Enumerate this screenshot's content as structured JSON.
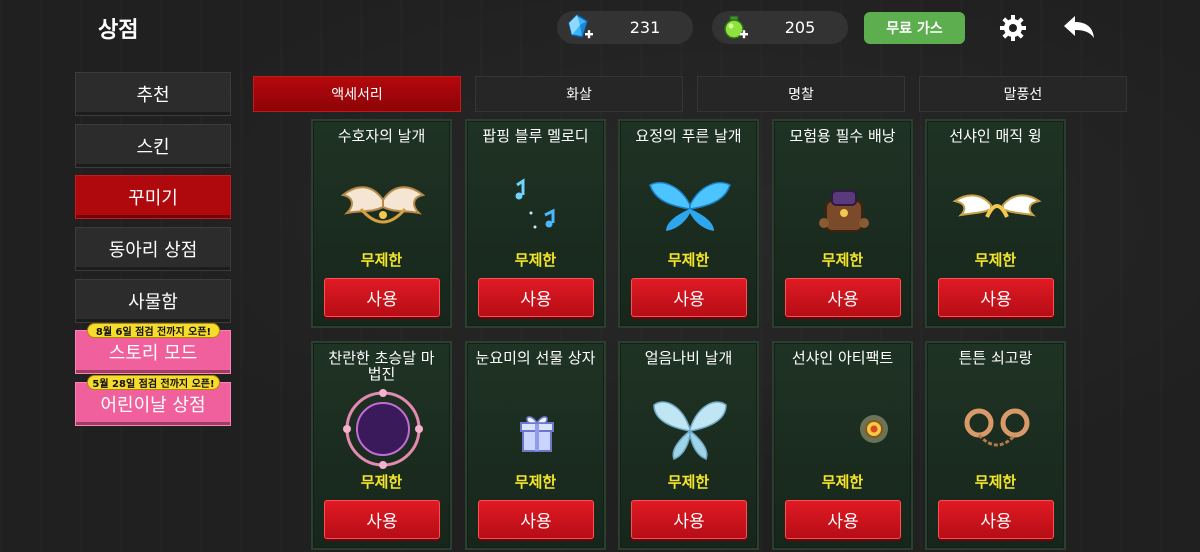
{
  "header": {
    "title": "상점",
    "gem_count": "231",
    "gas_count": "205",
    "free_gas_label": "무료 가스"
  },
  "sidebar": {
    "items": [
      {
        "label": "추천"
      },
      {
        "label": "스킨"
      },
      {
        "label": "꾸미기",
        "active": true
      },
      {
        "label": "동아리 상점"
      },
      {
        "label": "사물함"
      },
      {
        "label": "스토리 모드",
        "badge": "8월 6일 점검 전까지 오픈!"
      },
      {
        "label": "어린이날 상점",
        "badge": "5월 28일 점검 전까지 오픈!"
      }
    ]
  },
  "tabs": [
    {
      "label": "액세서리",
      "active": true
    },
    {
      "label": "화살"
    },
    {
      "label": "명찰"
    },
    {
      "label": "말풍선"
    }
  ],
  "items": [
    {
      "name": "수호자의 날개",
      "limit": "무제한",
      "button": "사용",
      "icon": "golden-wings-icon"
    },
    {
      "name": "팝핑 블루 멜로디",
      "limit": "무제한",
      "button": "사용",
      "icon": "music-notes-icon"
    },
    {
      "name": "요정의 푸른 날개",
      "limit": "무제한",
      "button": "사용",
      "icon": "blue-fairy-wings-icon"
    },
    {
      "name": "모험용 필수 배낭",
      "limit": "무제한",
      "button": "사용",
      "icon": "backpack-icon"
    },
    {
      "name": "선샤인 매직 윙",
      "limit": "무제한",
      "button": "사용",
      "icon": "white-angel-wings-icon"
    },
    {
      "name": "찬란한 초승달 마법진",
      "limit": "무제한",
      "button": "사용",
      "icon": "crescent-magic-circle-icon"
    },
    {
      "name": "눈요미의 선물 상자",
      "limit": "무제한",
      "button": "사용",
      "icon": "gift-box-icon"
    },
    {
      "name": "얼음나비 날개",
      "limit": "무제한",
      "button": "사용",
      "icon": "ice-butterfly-wings-icon"
    },
    {
      "name": "선샤인 아티팩트",
      "limit": "무제한",
      "button": "사용",
      "icon": "sun-artifact-icon"
    },
    {
      "name": "튼튼 쇠고랑",
      "limit": "무제한",
      "button": "사용",
      "icon": "handcuffs-icon"
    }
  ],
  "colors": {
    "accent_red": "#b0090d",
    "use_button": "#d8141f",
    "limit_text": "#f2e52a",
    "free_gas": "#5cae4e",
    "promo_pink": "#f0609c",
    "card_bg": "#1f3324"
  }
}
